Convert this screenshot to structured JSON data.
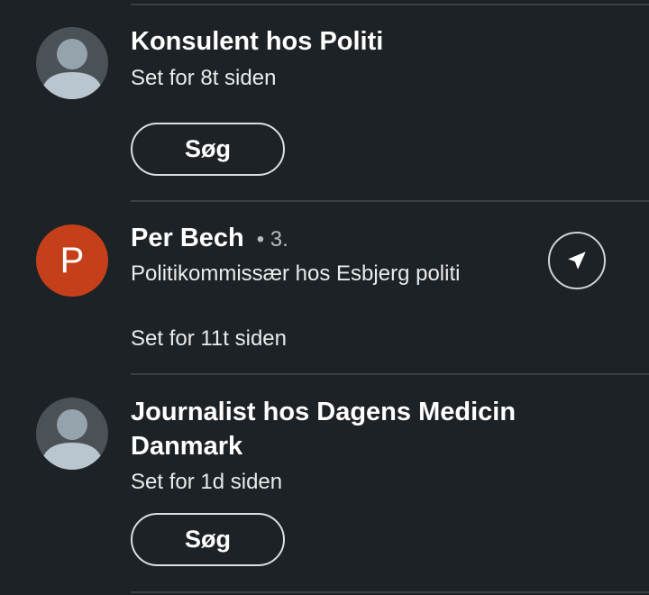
{
  "items": [
    {
      "title": "Konsulent hos Politi",
      "time": "Set for 8t siden",
      "button_label": "Søg",
      "avatar": "ghost-avatar"
    },
    {
      "name": "Per Bech",
      "degree": "• 3.",
      "subtitle": "Politikommissær hos Esbjerg politi",
      "time": "Set for 11t siden",
      "avatar_letter": "P",
      "avatar_color": "#c5401a",
      "action_icon": "send-icon"
    },
    {
      "title": "Journalist hos Dagens Medicin Danmark",
      "time": "Set for 1d siden",
      "button_label": "Søg",
      "avatar": "ghost-avatar"
    }
  ],
  "colors": {
    "background": "#1d2226",
    "divider": "#3a4045",
    "text_primary": "#ffffff",
    "text_secondary": "#e9ebec"
  }
}
